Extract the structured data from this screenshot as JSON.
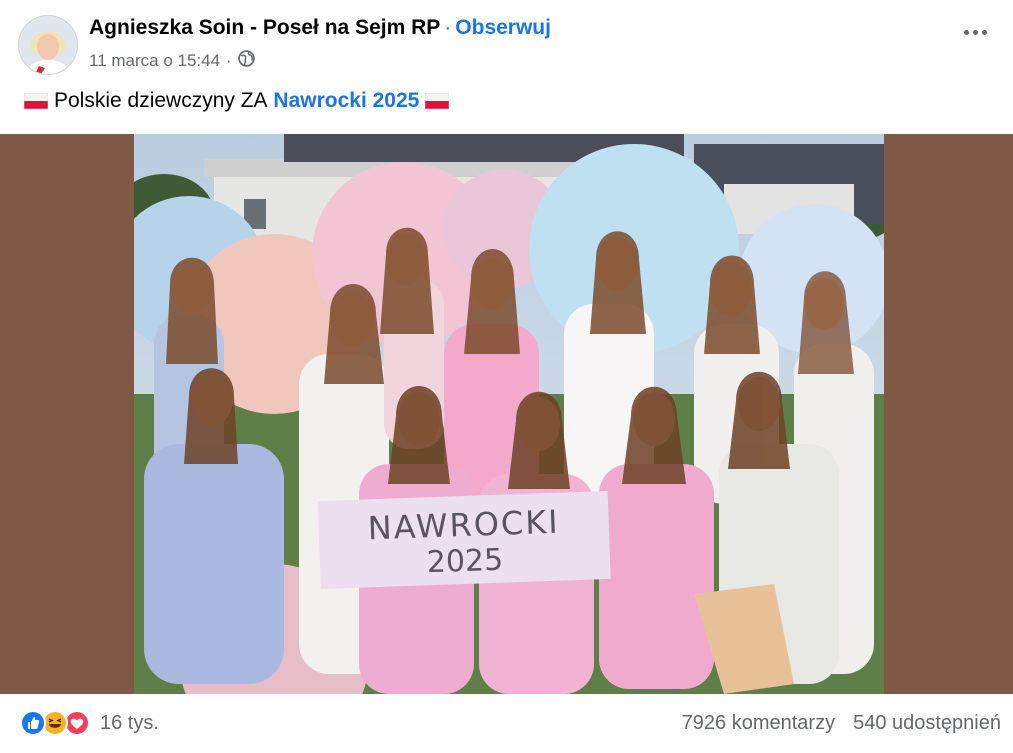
{
  "post": {
    "author": "Agnieszka Soin - Poseł na Sejm RP",
    "separator": "·",
    "follow_label": "Obserwuj",
    "timestamp": "11 marca o 15:44",
    "meta_separator": "·",
    "audience_icon": "globe-icon",
    "menu_icon": "more-horizontal-icon",
    "caption_before": "Polskie dziewczyny ZA",
    "caption_link": "Nawrocki 2025",
    "caption_flag": "poland-flag-emoji"
  },
  "image": {
    "banner_line1": "NAWROCKI",
    "banner_line2": "2025",
    "background_color": "#7f5846"
  },
  "footer": {
    "reaction_icons": [
      "like-icon",
      "haha-icon",
      "love-icon"
    ],
    "reaction_count": "16 tys.",
    "comments": "7926 komentarzy",
    "shares": "540 udostępnień"
  },
  "colors": {
    "link": "#1b74e4",
    "secondary_text": "#65676b",
    "like": "#1877f2",
    "love": "#f33e58",
    "haha": "#f7b125"
  }
}
